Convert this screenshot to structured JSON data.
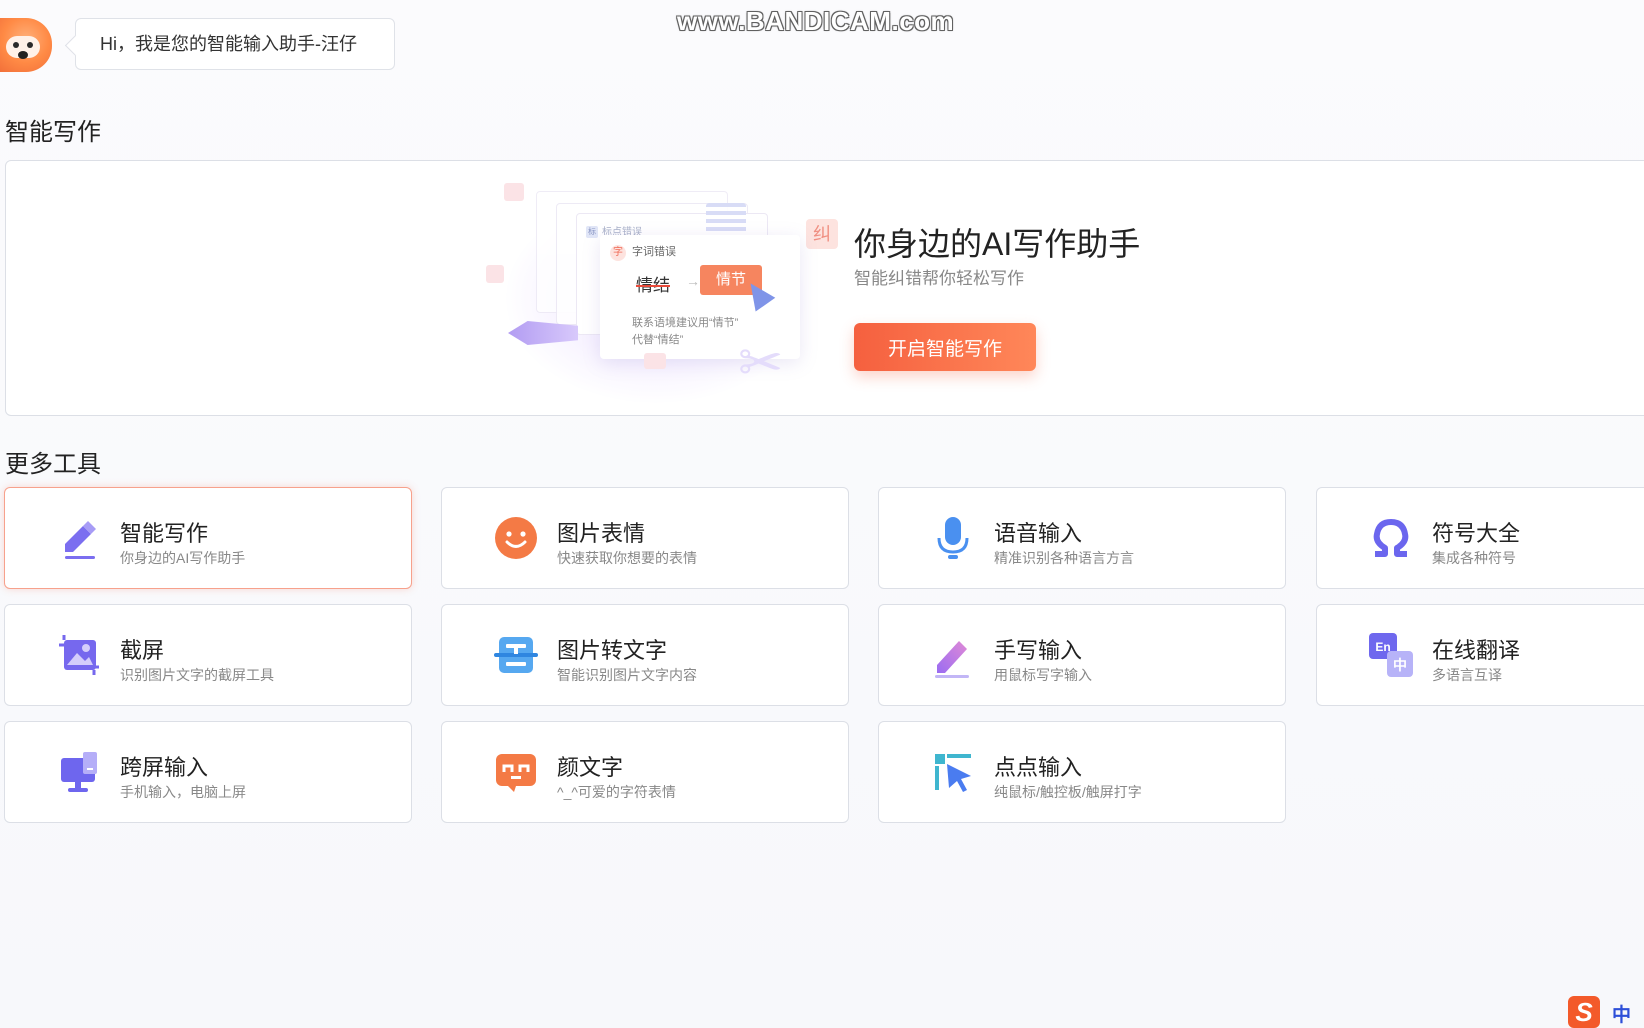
{
  "header": {
    "greeting": "Hi，我是您的智能输入助手-汪仔",
    "watermark": "www.BANDICAM.com"
  },
  "sections": {
    "smart_writing_title": "智能写作",
    "more_tools_title": "更多工具"
  },
  "hero": {
    "title": "你身边的AI写作助手",
    "subtitle": "智能纠错帮你轻松写作",
    "button_label": "开启智能写作",
    "illustration": {
      "tag_punct": "标点错误",
      "tag_mini": "标",
      "error_head": "字词错误",
      "error_dot": "字",
      "wrong_word": "情结",
      "arrow": "→",
      "correct_word": "情节",
      "hint_line1": "联系语境建议用“情节”",
      "hint_line2": "代替“情结”",
      "corner_char": "纠"
    },
    "accent_color": "#f5603f"
  },
  "tools": [
    {
      "name": "智能写作",
      "desc": "你身边的AI写作助手",
      "icon": "pen-write-icon",
      "active": true
    },
    {
      "name": "图片表情",
      "desc": "快速获取你想要的表情",
      "icon": "smiley-icon",
      "active": false
    },
    {
      "name": "语音输入",
      "desc": "精准识别各种语言方言",
      "icon": "microphone-icon",
      "active": false
    },
    {
      "name": "符号大全",
      "desc": "集成各种符号",
      "icon": "omega-icon",
      "active": false
    },
    {
      "name": "截屏",
      "desc": "识别图片文字的截屏工具",
      "icon": "screenshot-icon",
      "active": false
    },
    {
      "name": "图片转文字",
      "desc": "智能识别图片文字内容",
      "icon": "ocr-icon",
      "active": false
    },
    {
      "name": "手写输入",
      "desc": "用鼠标写字输入",
      "icon": "handwrite-icon",
      "active": false
    },
    {
      "name": "在线翻译",
      "desc": "多语言互译",
      "icon": "translate-icon",
      "active": false,
      "icon_text_a": "En",
      "icon_text_b": "中"
    },
    {
      "name": "跨屏输入",
      "desc": "手机输入，电脑上屏",
      "icon": "cross-screen-icon",
      "active": false
    },
    {
      "name": "颜文字",
      "desc": "^_^可爱的字符表情",
      "icon": "kaomoji-icon",
      "active": false
    },
    {
      "name": "点点输入",
      "desc": "纯鼠标/触控板/触屏打字",
      "icon": "click-input-icon",
      "active": false
    }
  ],
  "ime": {
    "logo": "S",
    "mode": "中"
  }
}
